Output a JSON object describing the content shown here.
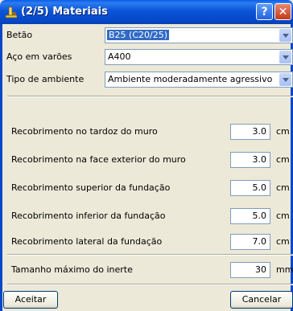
{
  "window": {
    "title": "(2/5) Materiais",
    "help_label": "?",
    "close_label": "✕"
  },
  "fields": {
    "betao": {
      "label": "Betão",
      "value": "B25 (C20/25)"
    },
    "aco": {
      "label": "Aço em varões",
      "value": "A400"
    },
    "ambiente": {
      "label": "Tipo de ambiente",
      "value": "Ambiente moderadamente agressivo"
    }
  },
  "covers": [
    {
      "label": "Recobrimento no tardoz do muro",
      "value": "3.0",
      "unit": "cm"
    },
    {
      "label": "Recobrimento na face exterior do muro",
      "value": "3.0",
      "unit": "cm"
    },
    {
      "label": "Recobrimento superior da fundação",
      "value": "5.0",
      "unit": "cm"
    },
    {
      "label": "Recobrimento inferior da fundação",
      "value": "5.0",
      "unit": "cm"
    },
    {
      "label": "Recobrimento lateral da fundação",
      "value": "7.0",
      "unit": "cm"
    }
  ],
  "aggregate": {
    "label": "Tamanho máximo do inerte",
    "value": "30",
    "unit": "mm"
  },
  "buttons": {
    "accept": "Aceitar",
    "cancel": "Cancelar"
  }
}
